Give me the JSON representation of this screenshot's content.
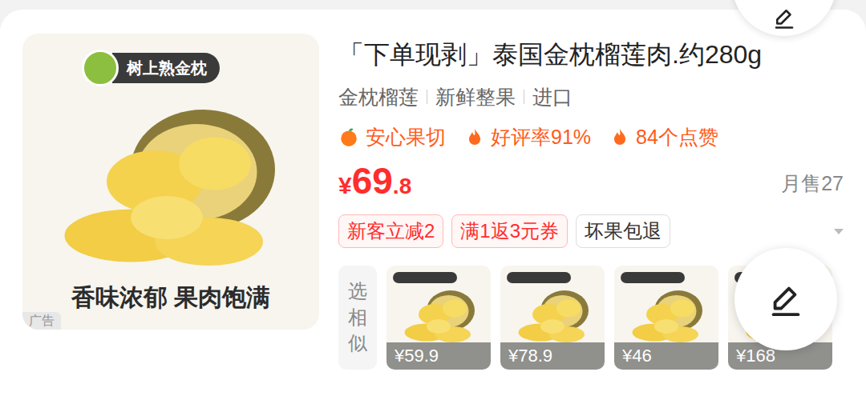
{
  "product": {
    "image": {
      "badge": "树上熟金枕",
      "slogan": "香味浓郁 果肉饱满",
      "ad_label": "广告"
    },
    "title": "「下单现剥」泰国金枕榴莲肉.约280g",
    "tags": [
      "金枕榴莲",
      "新鲜整果",
      "进口"
    ],
    "features": [
      {
        "label": "安心果切",
        "kind": "apple"
      },
      {
        "label": "好评率91%",
        "kind": "flame"
      },
      {
        "label": "84个点赞",
        "kind": "flame"
      }
    ],
    "price": {
      "currency": "¥",
      "integer": "69",
      "decimal": ".8"
    },
    "monthly_sales": "月售27",
    "coupons": [
      {
        "label": "新客立减2",
        "kind": "promo"
      },
      {
        "label": "满1返3元券",
        "kind": "promo"
      },
      {
        "label": "坏果包退",
        "kind": "service"
      }
    ],
    "similar": {
      "label": "选相似",
      "items": [
        {
          "price": "¥59.9"
        },
        {
          "price": "¥78.9"
        },
        {
          "price": "¥46"
        },
        {
          "price": "¥168"
        }
      ]
    }
  }
}
